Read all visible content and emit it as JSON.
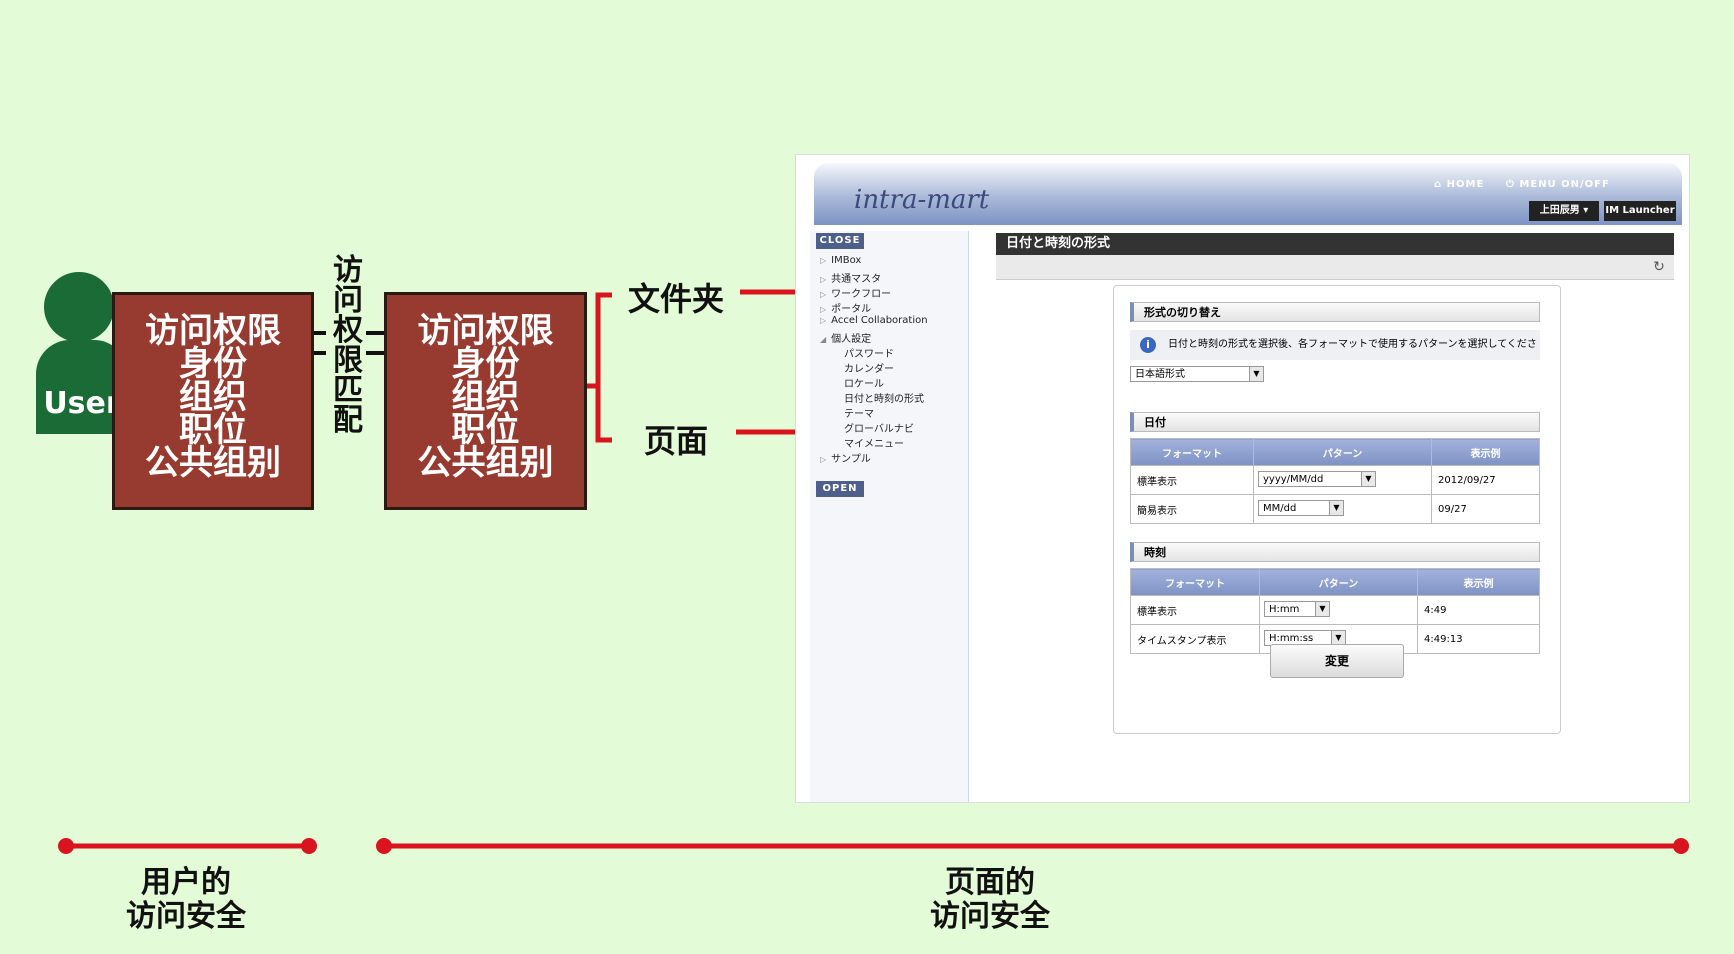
{
  "user": {
    "label": "User"
  },
  "box_left": {
    "lines": [
      "访问权限",
      "身份",
      "组织",
      "职位",
      "公共组别"
    ]
  },
  "match_label": [
    "访",
    "问",
    "权",
    "限",
    "匹",
    "配"
  ],
  "box_right": {
    "lines": [
      "访问权限",
      "身份",
      "组织",
      "职位",
      "公共组别"
    ]
  },
  "targets": {
    "folder": "文件夹",
    "page": "页面"
  },
  "captions": {
    "user_security": [
      "用户的",
      "访问安全"
    ],
    "page_security": [
      "页面的",
      "访问安全"
    ]
  },
  "colors": {
    "line_red": "#d9141e",
    "box_red": "#973a2f",
    "user_green": "#1a6b35",
    "bg": "#e3fbd6"
  },
  "screenshot": {
    "logo": "intra-mart",
    "nav": {
      "home": "HOME",
      "menu": "MENU ON/OFF"
    },
    "user_button": "上田辰男",
    "launcher_button": "IM Launcher",
    "side_close": "CLOSE",
    "side_open": "OPEN",
    "side_items": [
      {
        "label": "IMBox",
        "indent": 0,
        "marker": "▷"
      },
      {
        "label": "共通マスタ",
        "indent": 0,
        "marker": "▷"
      },
      {
        "label": "ワークフロー",
        "indent": 0,
        "marker": "▷"
      },
      {
        "label": "ポータル",
        "indent": 0,
        "marker": "▷"
      },
      {
        "label": "Accel Collaboration",
        "indent": 0,
        "marker": "▷"
      },
      {
        "label": "個人設定",
        "indent": 0,
        "marker": "◢"
      },
      {
        "label": "パスワード",
        "indent": 1,
        "marker": ""
      },
      {
        "label": "カレンダー",
        "indent": 1,
        "marker": ""
      },
      {
        "label": "ロケール",
        "indent": 1,
        "marker": ""
      },
      {
        "label": "日付と時刻の形式",
        "indent": 1,
        "marker": ""
      },
      {
        "label": "テーマ",
        "indent": 1,
        "marker": ""
      },
      {
        "label": "グローバルナビ",
        "indent": 1,
        "marker": ""
      },
      {
        "label": "マイメニュー",
        "indent": 1,
        "marker": ""
      },
      {
        "label": "サンプル",
        "indent": 0,
        "marker": "▷"
      }
    ],
    "page_title": "日付と時刻の形式",
    "section_format": "形式の切り替え",
    "info_text": "日付と時刻の形式を選択後、各フォーマットで使用するパターンを選択してください。",
    "format_select": "日本語形式",
    "section_date": "日付",
    "section_time": "時刻",
    "table_headers": [
      "フォーマット",
      "パターン",
      "表示例"
    ],
    "date_rows": [
      {
        "format": "標準表示",
        "pattern": "yyyy/MM/dd",
        "example": "2012/09/27"
      },
      {
        "format": "簡易表示",
        "pattern": "MM/dd",
        "example": "09/27"
      }
    ],
    "time_rows": [
      {
        "format": "標準表示",
        "pattern": "H:mm",
        "example": "4:49"
      },
      {
        "format": "タイムスタンプ表示",
        "pattern": "H:mm:ss",
        "example": "4:49:13"
      }
    ],
    "change_button": "変更"
  }
}
